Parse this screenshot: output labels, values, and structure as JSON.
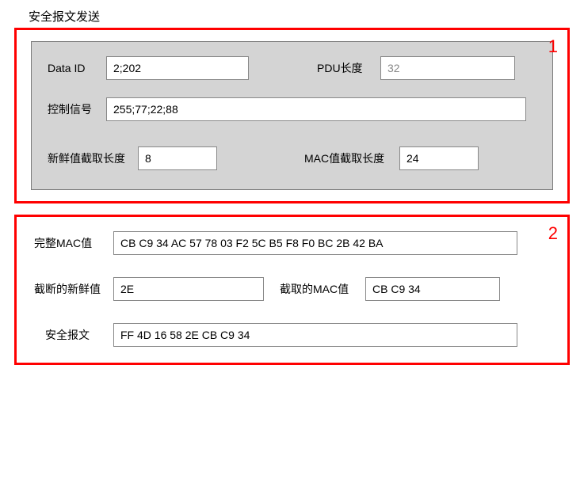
{
  "section_title": "安全报文发送",
  "box1": {
    "badge": "1",
    "data_id_label": "Data ID",
    "data_id_value": "2;202",
    "pdu_label": "PDU长度",
    "pdu_value": "32",
    "ctrl_label": "控制信号",
    "ctrl_value": "255;77;22;88",
    "fresh_len_label": "新鲜值截取长度",
    "fresh_len_value": "8",
    "mac_len_label": "MAC值截取长度",
    "mac_len_value": "24"
  },
  "box2": {
    "badge": "2",
    "full_mac_label": "完整MAC值",
    "full_mac_value": "CB C9 34 AC 57 78 03 F2 5C B5 F8 F0 BC 2B 42 BA",
    "trunc_fresh_label": "截断的新鲜值",
    "trunc_fresh_value": "2E",
    "trunc_mac_label": "截取的MAC值",
    "trunc_mac_value": "CB C9 34",
    "sec_msg_label": "安全报文",
    "sec_msg_value": "FF 4D 16 58 2E CB C9 34"
  }
}
